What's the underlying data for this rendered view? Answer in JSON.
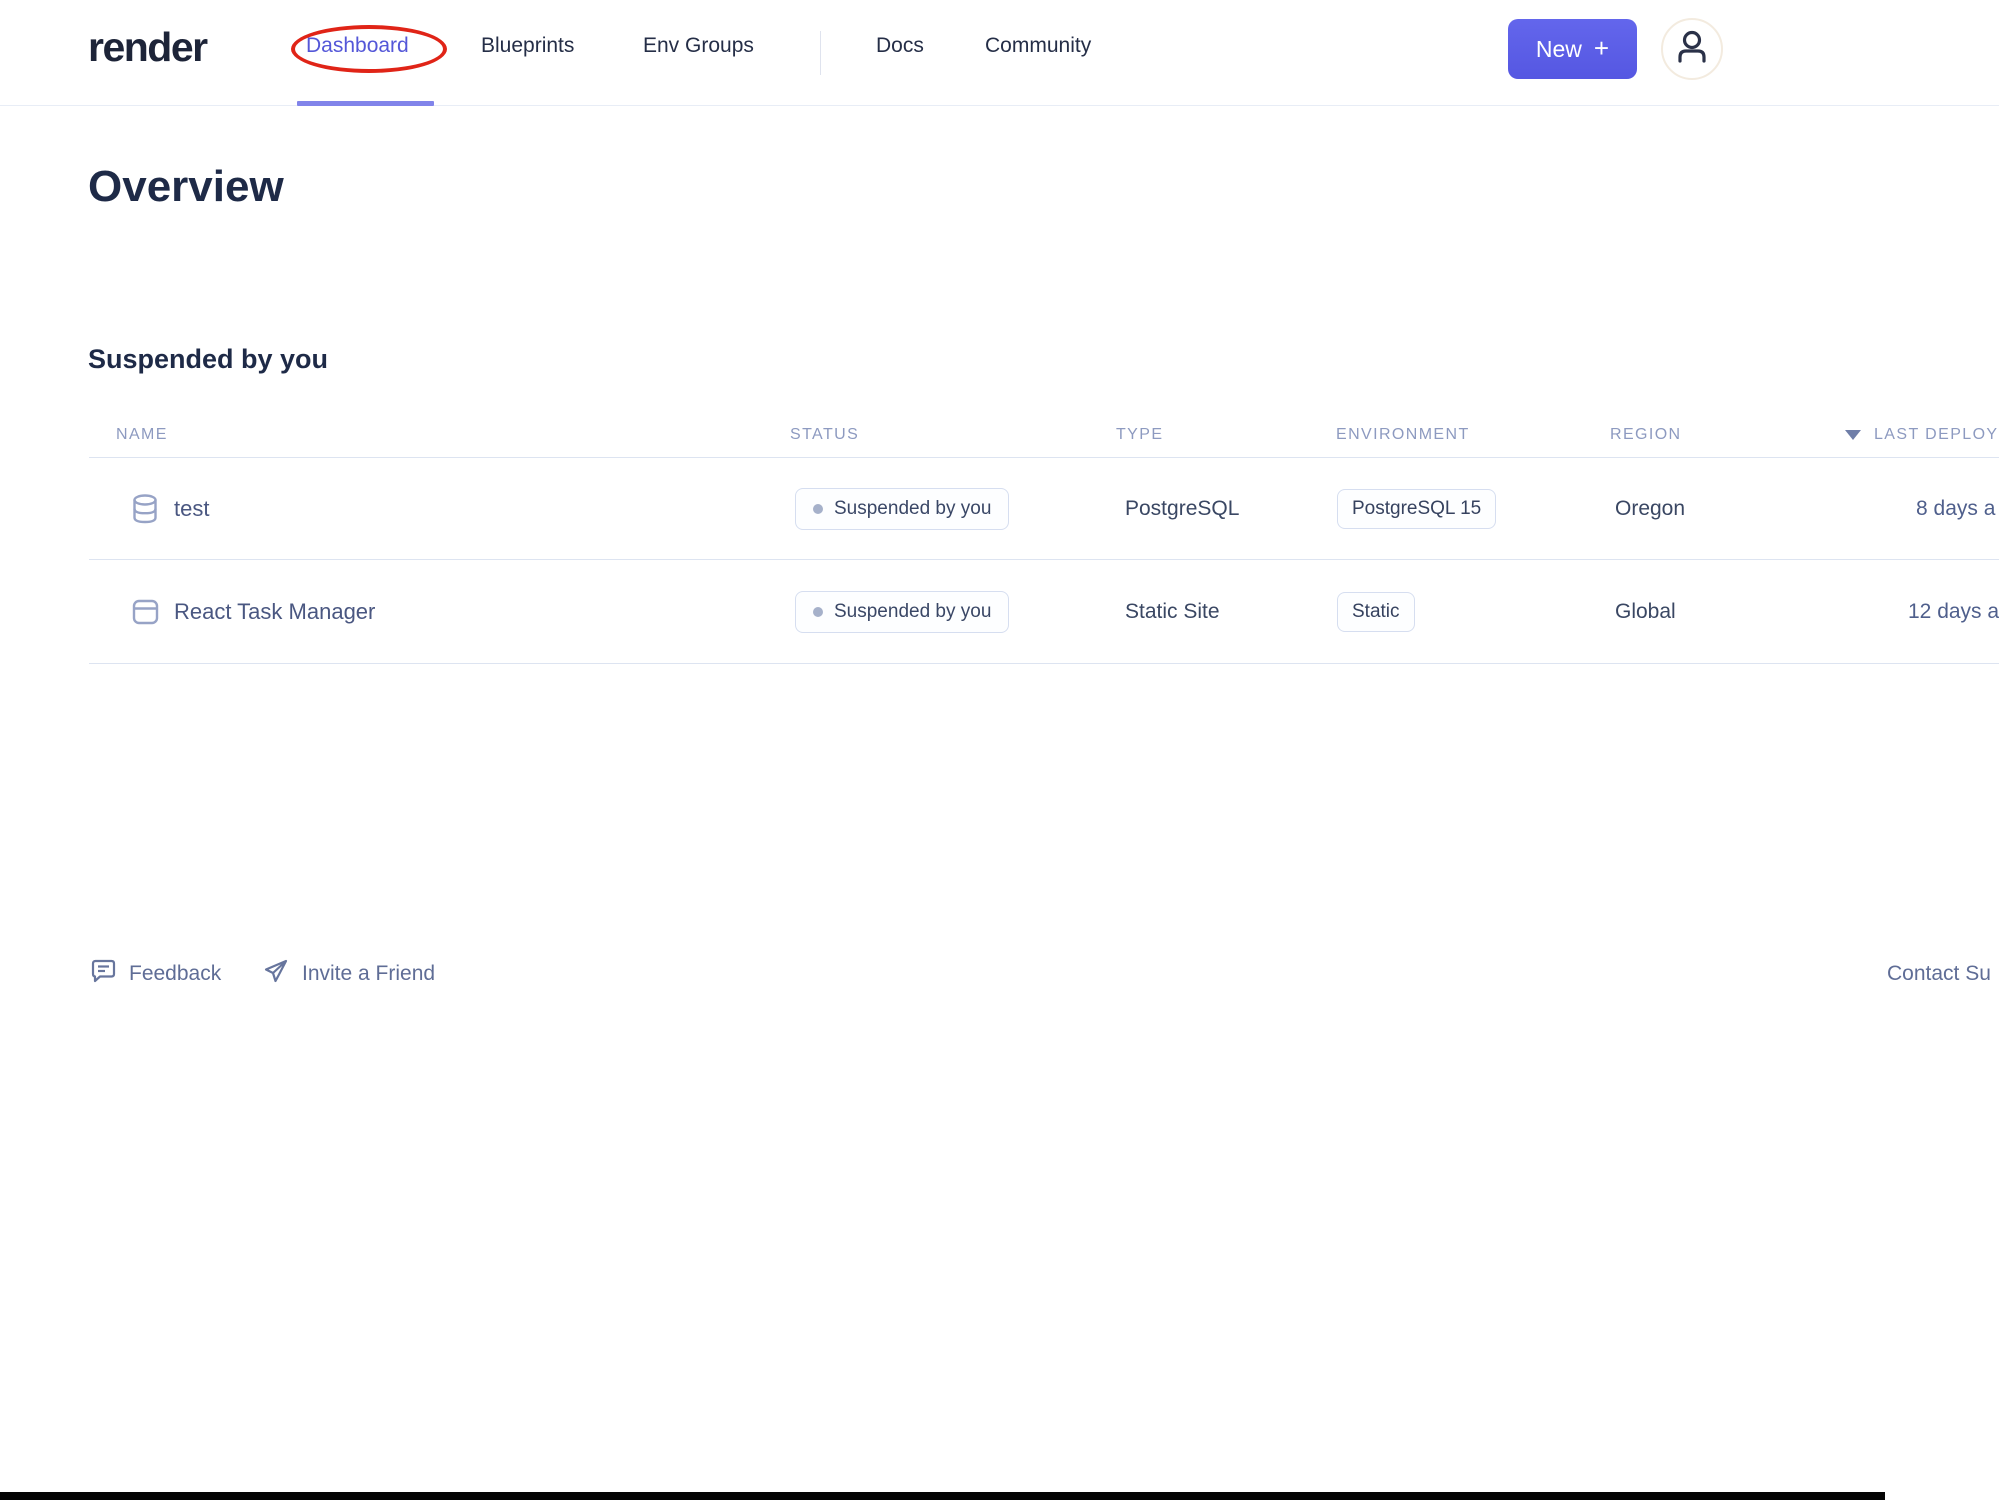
{
  "nav": {
    "logo": "render",
    "items": {
      "dashboard": "Dashboard",
      "blueprints": "Blueprints",
      "env_groups": "Env Groups",
      "docs": "Docs",
      "community": "Community"
    },
    "active_item": "Dashboard",
    "new_button": {
      "label": "New",
      "plus": "+"
    }
  },
  "annotation": {
    "shape": "red-ellipse",
    "target": "Dashboard",
    "color": "#e02417"
  },
  "page": {
    "title": "Overview",
    "section_title": "Suspended by you"
  },
  "table": {
    "headers": [
      "NAME",
      "STATUS",
      "TYPE",
      "ENVIRONMENT",
      "REGION",
      "LAST DEPLOY"
    ],
    "sort": {
      "column": "LAST DEPLOY",
      "direction": "desc"
    },
    "rows": [
      {
        "icon": "database",
        "name": "test",
        "status": "Suspended by you",
        "type": "PostgreSQL",
        "environment": "PostgreSQL 15",
        "region": "Oregon",
        "last_deploy": "8 days a"
      },
      {
        "icon": "static-site",
        "name": "React Task Manager",
        "status": "Suspended by you",
        "type": "Static Site",
        "environment": "Static",
        "region": "Global",
        "last_deploy": "12 days a"
      }
    ]
  },
  "footer": {
    "feedback": "Feedback",
    "invite": "Invite a Friend",
    "contact": "Contact Su"
  },
  "colors": {
    "accent_purple": "#5457d8",
    "button_purple": "#5b5de6",
    "heading": "#1e2a47",
    "header_slate": "#8d9ac0",
    "divider": "#dde4f1",
    "annotation_red": "#e02417"
  }
}
